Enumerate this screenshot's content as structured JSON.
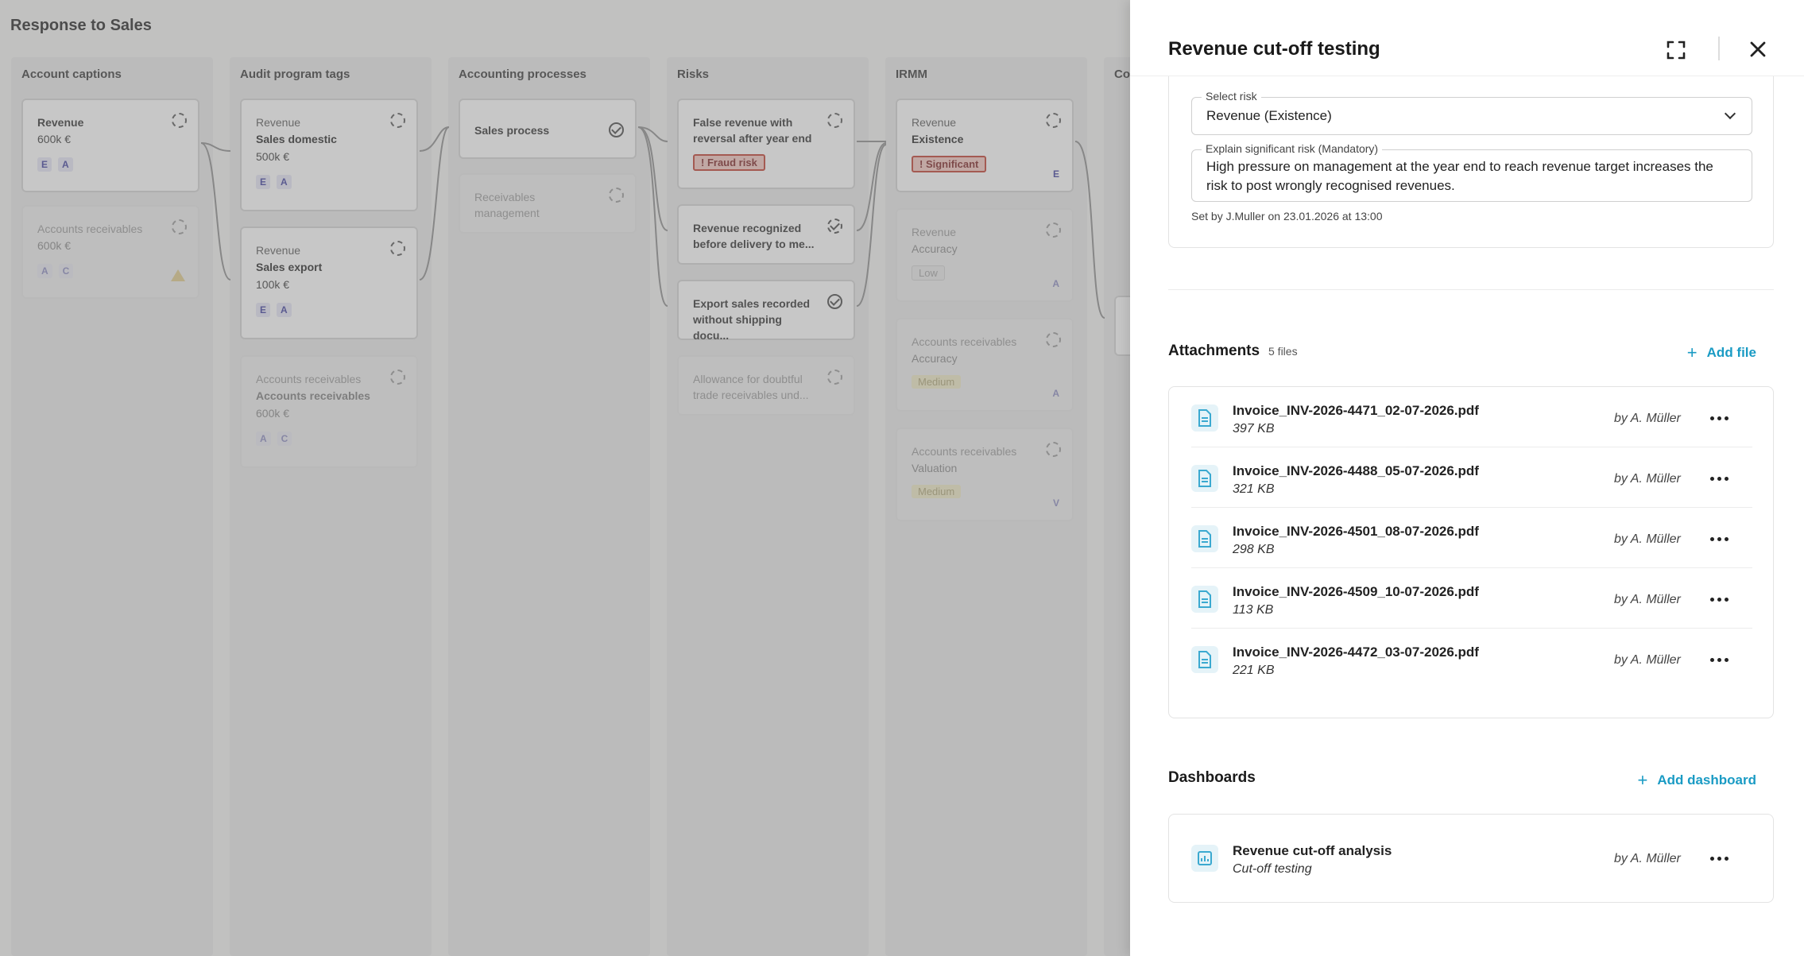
{
  "board": {
    "title": "Response to Sales",
    "columns": [
      {
        "title": "Account captions"
      },
      {
        "title": "Audit program tags"
      },
      {
        "title": "Accounting processes"
      },
      {
        "title": "Risks"
      },
      {
        "title": "IRMM"
      },
      {
        "title": "Co"
      }
    ],
    "account_captions": [
      {
        "line1": "Revenue",
        "line2": "600k €",
        "tags": [
          "E",
          "A"
        ]
      },
      {
        "line1": "Accounts receivables",
        "line2": "600k €",
        "tags": [
          "A",
          "C"
        ]
      }
    ],
    "audit_program_tags": [
      {
        "line1": "Revenue",
        "line2": "Sales domestic",
        "line3": "500k €",
        "tags": [
          "E",
          "A"
        ]
      },
      {
        "line1": "Revenue",
        "line2": "Sales export",
        "line3": "100k €",
        "tags": [
          "E",
          "A"
        ]
      },
      {
        "line1": "Accounts receivables",
        "line2": "Accounts receivables",
        "line3": "600k €",
        "tags": [
          "A",
          "C"
        ]
      }
    ],
    "accounting_processes": [
      {
        "line1": "Sales process"
      },
      {
        "line1": "Receivables management"
      }
    ],
    "risks": [
      {
        "line1": "False revenue with reversal after year end",
        "badge": "! Fraud risk"
      },
      {
        "line1": "Revenue recognized before delivery to me..."
      },
      {
        "line1": "Export sales recorded without shipping docu..."
      },
      {
        "line1": "Allowance for doubtful trade receivables und..."
      }
    ],
    "irmm": [
      {
        "line1": "Revenue",
        "line2": "Existence",
        "badge": "! Significant",
        "letter": "E"
      },
      {
        "line1": "Revenue",
        "line2": "Accuracy",
        "badge": "Low",
        "letter": "A"
      },
      {
        "line1": "Accounts receivables",
        "line2": "Accuracy",
        "badge": "Medium",
        "letter": "A"
      },
      {
        "line1": "Accounts receivables",
        "line2": "Valuation",
        "badge": "Medium",
        "letter": "V"
      }
    ]
  },
  "panel": {
    "title": "Revenue cut-off testing",
    "select_risk": {
      "label": "Select risk",
      "value": "Revenue (Existence)"
    },
    "explain_risk": {
      "label": "Explain significant risk (Mandatory)",
      "value": "High pressure on management at the year end to reach revenue target increases the risk to post wrongly recognised revenues."
    },
    "set_by": "Set by J.Muller on 23.01.2026 at 13:00",
    "attachments": {
      "title": "Attachments",
      "count": "5 files",
      "add_label": "Add file",
      "items": [
        {
          "name": "Invoice_INV-2026-4471_02-07-2026.pdf",
          "size": "397 KB",
          "by": "by A. Müller"
        },
        {
          "name": "Invoice_INV-2026-4488_05-07-2026.pdf",
          "size": "321 KB",
          "by": "by A. Müller"
        },
        {
          "name": "Invoice_INV-2026-4501_08-07-2026.pdf",
          "size": "298 KB",
          "by": "by A. Müller"
        },
        {
          "name": "Invoice_INV-2026-4509_10-07-2026.pdf",
          "size": "113 KB",
          "by": "by A. Müller"
        },
        {
          "name": "Invoice_INV-2026-4472_03-07-2026.pdf",
          "size": "221 KB",
          "by": "by A. Müller"
        }
      ]
    },
    "dashboards": {
      "title": "Dashboards",
      "add_label": "Add dashboard",
      "items": [
        {
          "name": "Revenue cut-off analysis",
          "subtitle": "Cut-off testing",
          "by": "by A. Müller"
        }
      ]
    }
  },
  "colors": {
    "accent": "#1a9bc4",
    "fraud_badge": "#c0392b",
    "tag_text": "#3a3a9c"
  }
}
